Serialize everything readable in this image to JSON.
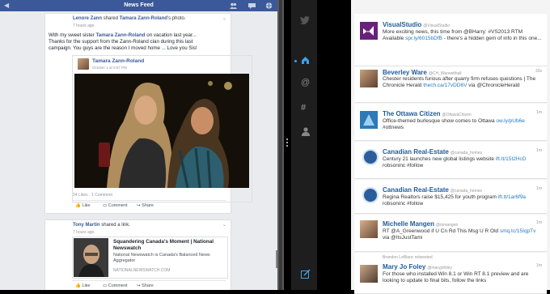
{
  "fb": {
    "title": "News Feed",
    "post1": {
      "actor": "Lenore Zann",
      "verb": "shared",
      "owner": "Tamara Zann-Roland",
      "owner_suffix": "'s photo.",
      "time": "7 hours ago",
      "text1a": "With my sweet sister ",
      "text1_name": "Tamara Zann-Roland",
      "text1b": " on vacation last year...",
      "text2": "Thanks for the support from the Zann-Roland clan during this last",
      "text3": "campaign. You guys are the reason I moved home ... Love you Sis!",
      "inner_name": "Tamara Zann-Roland",
      "inner_time": "October 1 at 6:57 PM",
      "counts": "24 Likes · 1 Comment",
      "like": "Like",
      "comment": "Comment",
      "share": "Share"
    },
    "post2": {
      "actor": "Tony Martin",
      "verb": "shared a link.",
      "time": "7 hours ago",
      "link_title": "Squandering Canada's Moment | National Newswatch",
      "link_desc": "National Newswatch is Canada's Balanced News Aggregator",
      "link_domain": "NATIONALNEWSWATCH.COM",
      "like": "Like",
      "comment": "Comment",
      "share": "Share"
    }
  },
  "tweets": [
    {
      "name": "VisualStudio",
      "handle": "@VisualStudio",
      "time": "",
      "text": "More exciting news, this time from @BHarry: #VS2013 RTM Available ",
      "link": "spr.ly/6015bDfB",
      "text2": " - there's a hidden gem of info in this one..."
    },
    {
      "name": "Beverley Ware",
      "handle": "@CH_Warewithall",
      "time": "33s",
      "text": "Chester residents furious after quarry firm refuses questions | The Chronicle Herald ",
      "link": "thech.ca/17vDD6V",
      "text2": " via @ChronicleHerald"
    },
    {
      "name": "The Ottawa Citizen",
      "handle": "@OttawaCitizen",
      "time": "1m",
      "text": "Office-themed burlesque show comes to Ottawa ",
      "link": "ow.ly/pUb6e",
      "text2": " #ottnews"
    },
    {
      "name": "Canadian Real-Estate",
      "handle": "@canada_homes",
      "time": "1m",
      "text": "Century 21 launches new global listings website ",
      "link": "ift.tt/15I2HcD",
      "text2": " robsoninc #follow"
    },
    {
      "name": "Canadian Real-Estate",
      "handle": "@canada_homes",
      "time": "1m",
      "text": "Regina Realtors raise $15,425 for youth program ",
      "link": "ift.tt/1ar6f9a",
      "text2": " robsoninc #follow"
    },
    {
      "name": "Michelle Mangen",
      "handle": "@mmangen",
      "time": "1m",
      "text": "RT @A_Greenwood if U Cn Rd This Msg U R Old ",
      "link": "smq.tc/15IqpTv",
      "text2": " via @ItsJustTami"
    },
    {
      "name": "Mary Jo Foley",
      "handle": "@maryjofoley",
      "time": "1m",
      "retweet": "Brandon LeBlanc retweeted",
      "text": "For those who installed Win 8.1 or Win RT 8.1 preview and are looking to update to final bits, follow the links",
      "link": "",
      "text2": ""
    }
  ]
}
